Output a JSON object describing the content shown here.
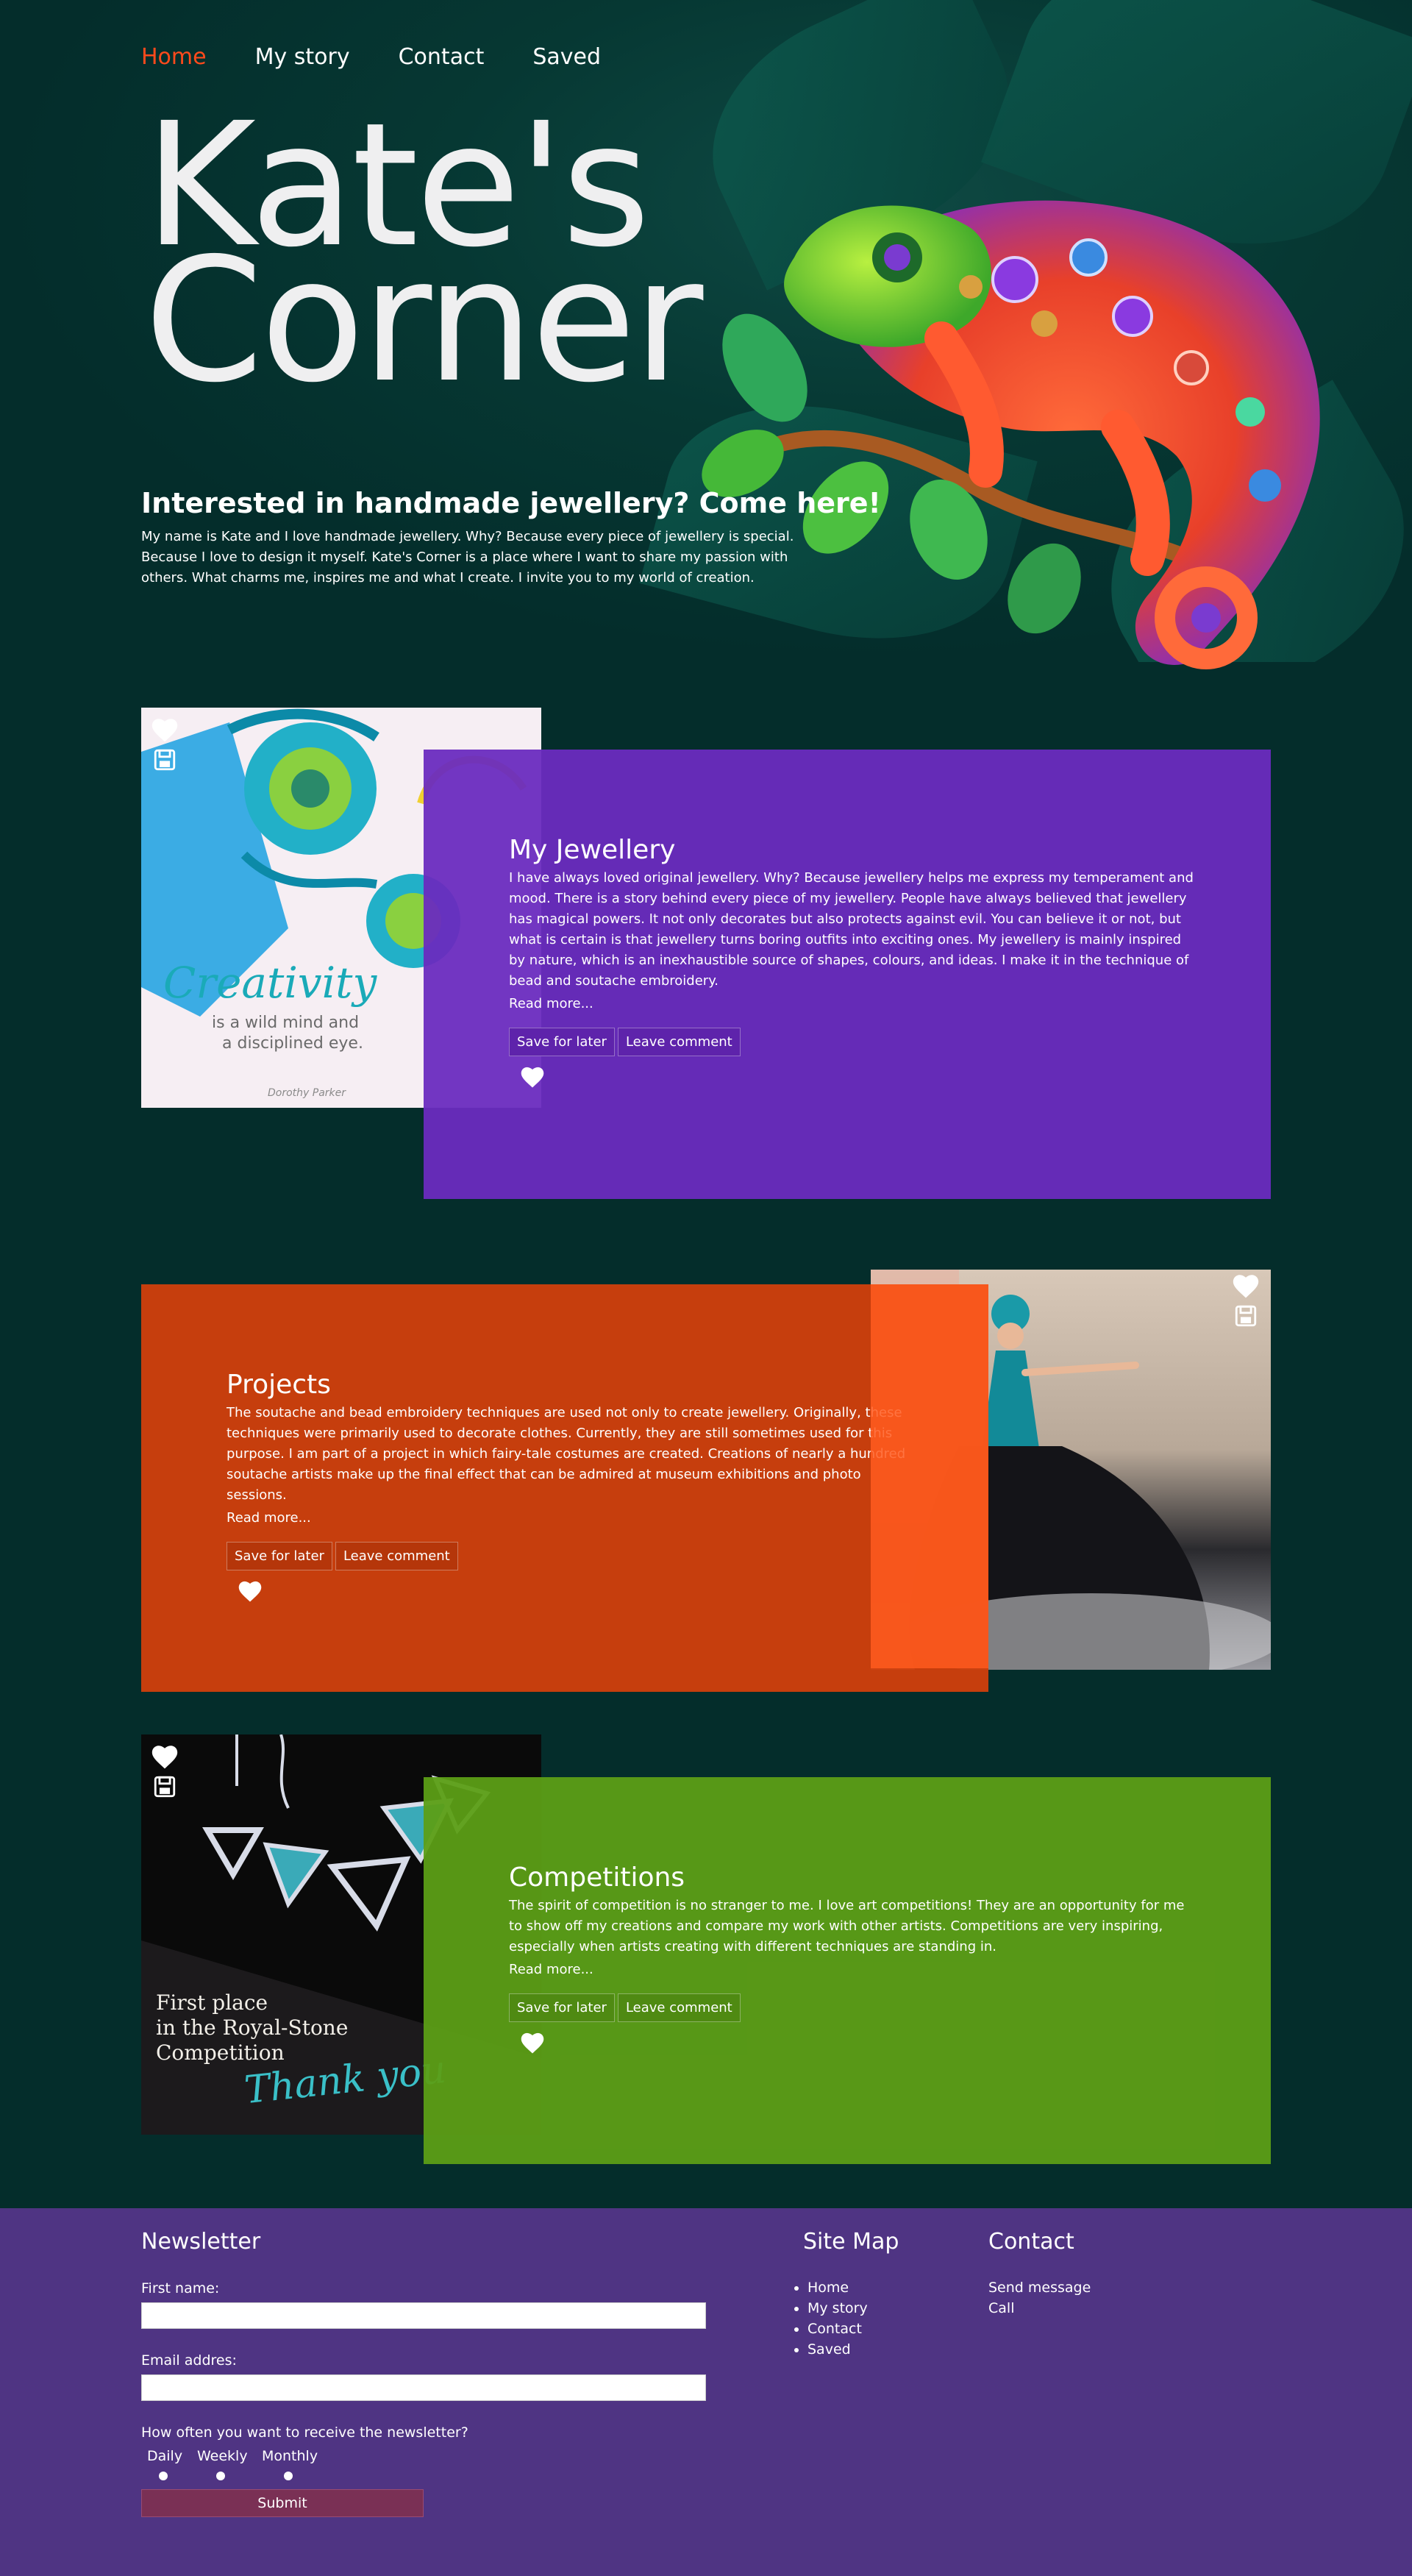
{
  "nav": {
    "items": [
      "Home",
      "My story",
      "Contact",
      "Saved"
    ]
  },
  "hero": {
    "title_line1": "Kate's",
    "title_line2": "Corner",
    "heading": "Interested in handmade jewellery? Come here!",
    "text": "My name is Kate and I love handmade jewellery. Why? Because every piece of jewellery is special. Because I love to design it myself. Kate's Corner is a place where I want to share my passion with others. What charms me, inspires me and what I create. I invite you to my world of creation."
  },
  "cards": [
    {
      "title": "My Jewellery",
      "text": "I have always loved original jewellery. Why? Because jewellery helps me express my temperament and mood. There is a story behind every piece of my jewellery. People have always believed that jewellery has magical powers. It not only decorates but also protects against evil. You can believe it or not, but what is certain is that jewellery turns boring outfits into exciting ones. My jewellery is mainly inspired by nature, which is an inexhaustible source of shapes, colours, and ideas. I make it in the technique of bead and soutache embroidery.",
      "read_more": "Read more...",
      "save_label": "Save for later",
      "comment_label": "Leave comment",
      "color": "#6a2bbf",
      "image_text_1": "Creativity",
      "image_text_2": "is a wild mind and",
      "image_text_3": "a disciplined eye.",
      "image_text_4": "Dorothy Parker"
    },
    {
      "title": "Projects",
      "text": "The soutache and bead embroidery techniques are used not only to create jewellery. Originally, these techniques were primarily used to decorate clothes. Currently, they are still sometimes used for this purpose. I am part of a project in which fairy-tale costumes are created. Creations of nearly a hundred soutache artists make up the final effect that can be admired at museum exhibitions and photo sessions.",
      "read_more": "Read more...",
      "save_label": "Save for later",
      "comment_label": "Leave comment",
      "color": "#cc3f0c"
    },
    {
      "title": "Competitions",
      "text": "The spirit of competition is no stranger to me. I love art competitions! They are an opportunity for me to show off my creations and compare my work with other artists. Competitions are very inspiring, especially when artists creating with different techniques are standing in.",
      "read_more": "Read more...",
      "save_label": "Save for later",
      "comment_label": "Leave comment",
      "color": "#5c9e16",
      "image_text_1": "First place",
      "image_text_2": "in the Royal-Stone",
      "image_text_3": "Competition",
      "image_text_4": "Thank you"
    }
  ],
  "footer": {
    "newsletter_title": "Newsletter",
    "first_name_label": "First name:",
    "email_label": "Email addres:",
    "frequency_label": "How often you want to receive the newsletter?",
    "options": [
      "Daily",
      "Weekly",
      "Monthly"
    ],
    "submit_label": "Submit",
    "sitemap_title": "Site Map",
    "sitemap_items": [
      "Home",
      "My story",
      "Contact",
      "Saved"
    ],
    "contact_title": "Contact",
    "contact_items": [
      "Send message",
      "Call"
    ]
  }
}
